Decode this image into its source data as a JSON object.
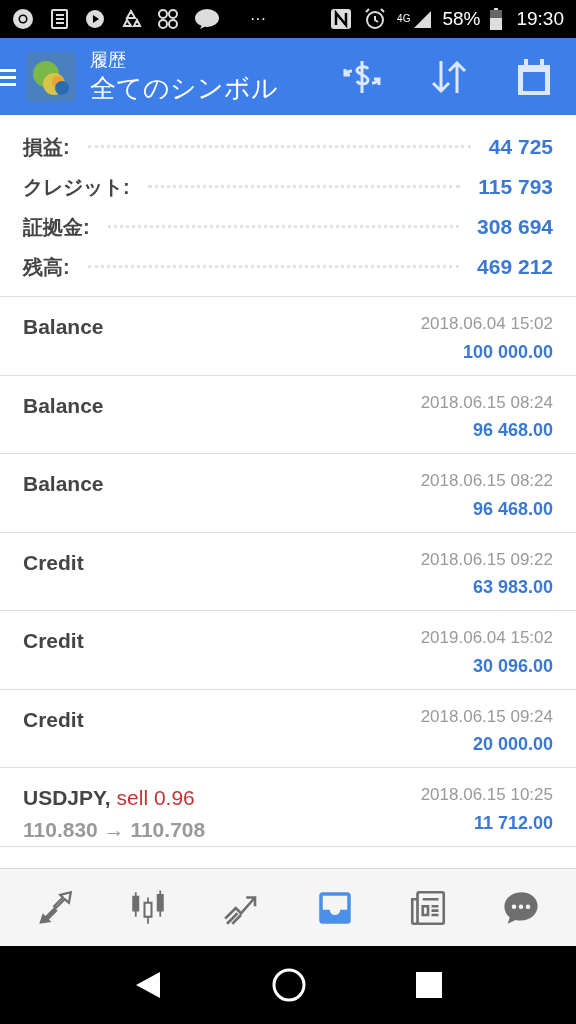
{
  "status_bar": {
    "more": "···",
    "network": "4G",
    "battery": "58%",
    "time": "19:30"
  },
  "header": {
    "title": "履歴",
    "subtitle": "全てのシンボル"
  },
  "summary": [
    {
      "label": "損益:",
      "value": "44 725"
    },
    {
      "label": "クレジット:",
      "value": "115 793"
    },
    {
      "label": "証拠金:",
      "value": "308 694"
    },
    {
      "label": "残高:",
      "value": "469 212"
    }
  ],
  "deals": [
    {
      "kind": "operation",
      "title": "Balance",
      "time": "2018.06.04 15:02",
      "amount": "100 000.00"
    },
    {
      "kind": "operation",
      "title": "Balance",
      "time": "2018.06.15 08:24",
      "amount": "96 468.00"
    },
    {
      "kind": "operation",
      "title": "Balance",
      "time": "2018.06.15 08:22",
      "amount": "96 468.00"
    },
    {
      "kind": "operation",
      "title": "Credit",
      "time": "2018.06.15 09:22",
      "amount": "63 983.00"
    },
    {
      "kind": "operation",
      "title": "Credit",
      "time": "2019.06.04 15:02",
      "amount": "30 096.00"
    },
    {
      "kind": "operation",
      "title": "Credit",
      "time": "2018.06.15 09:24",
      "amount": "20 000.00"
    },
    {
      "kind": "trade",
      "title": "USDJPY,",
      "action": "sell 0.96",
      "prices": "110.830 → 110.708",
      "time": "2018.06.15 10:25",
      "amount": "11 712.00"
    }
  ],
  "nav": [
    {
      "kind": "quotes",
      "selected": false
    },
    {
      "kind": "chart",
      "selected": false
    },
    {
      "kind": "trade",
      "selected": false
    },
    {
      "kind": "history",
      "selected": true
    },
    {
      "kind": "news",
      "selected": false
    },
    {
      "kind": "chat",
      "selected": false
    }
  ]
}
